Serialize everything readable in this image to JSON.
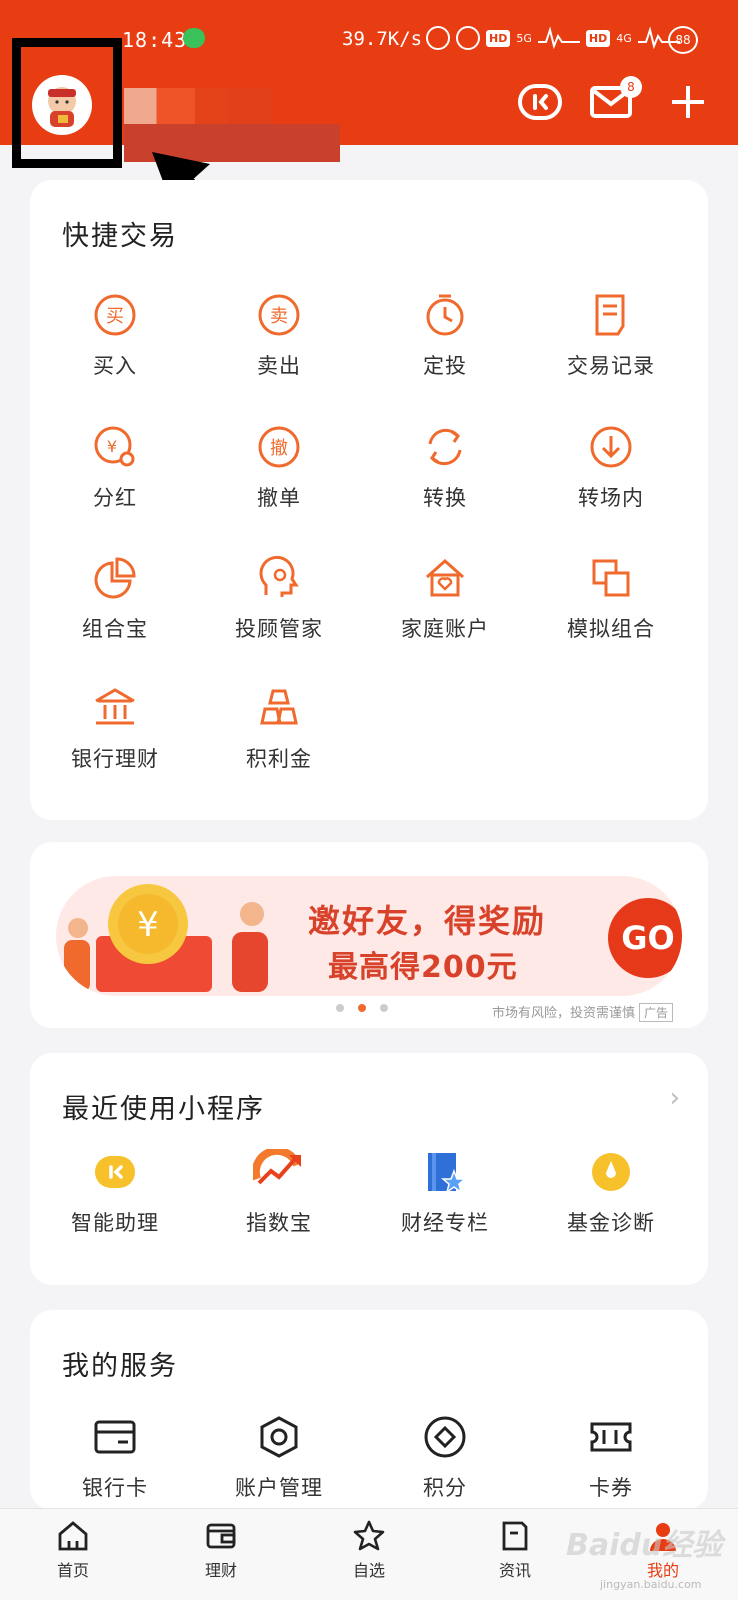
{
  "status_bar": {
    "time": "18:43",
    "net_speed": "39.7K/s",
    "hd1": "HD",
    "sig1": "5G",
    "hd2": "HD",
    "sig2": "4G",
    "battery": "88"
  },
  "header": {
    "mail_badge": "8"
  },
  "quick_trade": {
    "title": "快捷交易",
    "items": [
      {
        "label": "买入",
        "icon": "buy-icon"
      },
      {
        "label": "卖出",
        "icon": "sell-icon"
      },
      {
        "label": "定投",
        "icon": "timer-icon"
      },
      {
        "label": "交易记录",
        "icon": "record-icon"
      },
      {
        "label": "分红",
        "icon": "dividend-icon"
      },
      {
        "label": "撤单",
        "icon": "cancel-order-icon"
      },
      {
        "label": "转换",
        "icon": "convert-icon"
      },
      {
        "label": "转场内",
        "icon": "transfer-in-icon"
      },
      {
        "label": "组合宝",
        "icon": "pie-icon"
      },
      {
        "label": "投顾管家",
        "icon": "advisor-icon"
      },
      {
        "label": "家庭账户",
        "icon": "home-icon"
      },
      {
        "label": "模拟组合",
        "icon": "simulate-icon"
      },
      {
        "label": "银行理财",
        "icon": "bank-icon"
      },
      {
        "label": "积利金",
        "icon": "gold-icon"
      }
    ]
  },
  "banner": {
    "line1": "邀好友，得奖励",
    "line2": "最高得200元",
    "go": "GO",
    "coin_symbol": "¥",
    "disclaimer": "市场有风险，投资需谨慎",
    "ad_tag": "广告",
    "active_dot": 1
  },
  "recent_apps": {
    "title": "最近使用小程序",
    "chevron": "›",
    "items": [
      {
        "label": "智能助理",
        "icon": "assistant-icon"
      },
      {
        "label": "指数宝",
        "icon": "index-icon"
      },
      {
        "label": "财经专栏",
        "icon": "column-icon"
      },
      {
        "label": "基金诊断",
        "icon": "diagnose-icon"
      }
    ]
  },
  "services": {
    "title": "我的服务",
    "items": [
      {
        "label": "银行卡",
        "icon": "bank-card-icon"
      },
      {
        "label": "账户管理",
        "icon": "account-manage-icon"
      },
      {
        "label": "积分",
        "icon": "points-icon"
      },
      {
        "label": "卡券",
        "icon": "coupon-icon"
      }
    ]
  },
  "tabbar": {
    "items": [
      {
        "label": "首页",
        "icon": "home-tab-icon"
      },
      {
        "label": "理财",
        "icon": "wallet-tab-icon"
      },
      {
        "label": "自选",
        "icon": "star-tab-icon"
      },
      {
        "label": "资讯",
        "icon": "news-tab-icon"
      },
      {
        "label": "我的",
        "icon": "me-tab-icon"
      }
    ],
    "active_index": 4
  },
  "watermark": {
    "brand": "Baidu经验",
    "url": "jingyan.baidu.com"
  },
  "colors": {
    "brand": "#e83c12",
    "icon_orange": "#ef6a2c"
  }
}
